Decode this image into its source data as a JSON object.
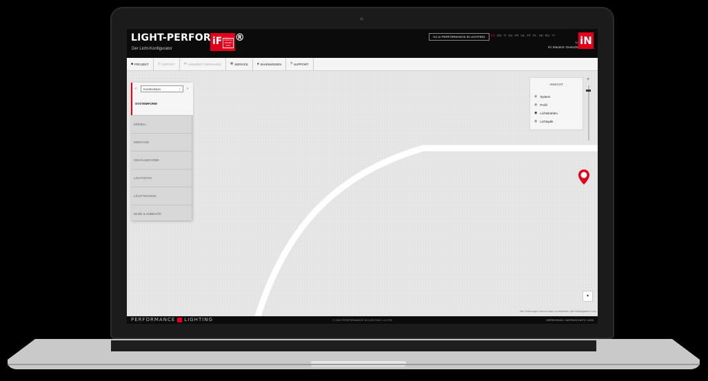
{
  "app": {
    "title": "LIGHT-PERFORMER®",
    "subtitle": "Der Licht-Konfigurator",
    "award_logo": "iF",
    "award_text": "DESIGN AWARD 2019",
    "goto_label": "Go to PERFORMANCE IN LIGHTING",
    "languages": [
      "DE",
      "EN",
      "IT",
      "ES",
      "FR",
      "NL",
      "PT",
      "PL",
      "SE",
      "RU",
      "??"
    ],
    "active_language": "DE",
    "login_label": "Login",
    "standort_label": "Ihr Standort: Deutschland",
    "brand_logo": "iN"
  },
  "menu": [
    {
      "label": "PROJEKT",
      "icon": "■",
      "icon_name": "project-icon",
      "disabled": false
    },
    {
      "label": "EXPORT",
      "icon": "◷",
      "icon_name": "export-icon",
      "disabled": true
    },
    {
      "label": "ANGEBOT ANFRAGEN",
      "icon": "⇄",
      "icon_name": "request-offer-icon",
      "disabled": true
    },
    {
      "label": "SERVICE",
      "icon": "⚒",
      "icon_name": "service-icon",
      "disabled": false
    },
    {
      "label": "BAHNWISSEN",
      "icon": "●",
      "icon_name": "knowledge-icon",
      "disabled": false
    },
    {
      "label": "SUPPORT",
      "icon": "?",
      "icon_name": "support-icon",
      "disabled": false
    }
  ],
  "side_panel": {
    "select_value": "Konstruktion",
    "select_clear": "×",
    "title": "SYSTEMFORM",
    "items": [
      "MODELL",
      "MONTAGE",
      "GEHÄUSEFARBE",
      "LICHTOPTIK",
      "LICHTTECHNIK",
      "MAßE & ZUBEHÖR"
    ]
  },
  "view_panel": {
    "title": "ANSICHT",
    "options": [
      {
        "label": "System",
        "active": false
      },
      {
        "label": "Profil",
        "active": false
      },
      {
        "label": "Lichtstrahlen",
        "active": true
      },
      {
        "label": "Lichtoptik",
        "active": false
      }
    ]
  },
  "zoom": {
    "plus": "+"
  },
  "canvas": {
    "corner_button": "▾",
    "disclaimer": "Alle Zeichnungen sind nur dazu zu betrachten. Alle Maßangaben in mm"
  },
  "footer": {
    "brand_left": "PERFORMANCE",
    "brand_right": "LIGHTING",
    "copyright": "© 2022 PERFORMANCE IN LIGHTING / v2.27B",
    "links": "IMPRESSUM / DATENSCHUTZ / AGB"
  },
  "colors": {
    "accent": "#e3001b",
    "header_bg": "#0b0b0b",
    "canvas_bg": "#e6e6e6"
  }
}
